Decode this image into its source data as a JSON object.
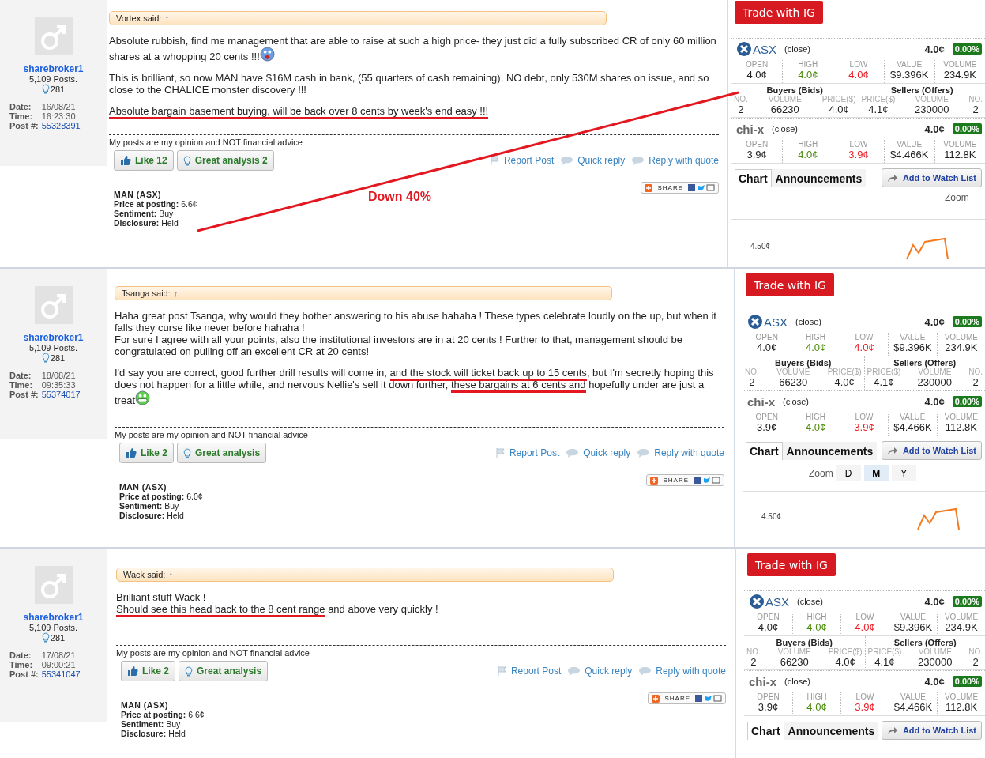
{
  "posts": [
    {
      "user": {
        "name": "sharebroker1",
        "posts": "5,109 Posts.",
        "likes": "281",
        "date_label": "Date:",
        "date": "16/08/21",
        "time_label": "Time:",
        "time": "16:23:30",
        "post_label": "Post #:",
        "post_no": "55328391"
      },
      "quote": {
        "author": "Vortex said:",
        "arrow": "↑"
      },
      "blocks": [
        [
          [
            {
              "kind": "text",
              "text": "Absolute rubbish, find me management that are able to raise at such a high price- they just did a fully subscribed CR of only 60 million shares at a whopping 20 cents !!!",
              "underlined": false
            },
            {
              "kind": "shocked"
            }
          ]
        ],
        [
          [
            {
              "kind": "text",
              "text": "This is brilliant, so now MAN have $16M cash in bank, (55 quarters of cash remaining), NO debt, only 530M shares on issue, and so close to the CHALICE monster discovery !!!",
              "underlined": false
            }
          ]
        ],
        [
          [
            {
              "kind": "text",
              "text": "Absolute bargain basement buying, will be back over 8 cents by week's end easy !!!",
              "underlined": true
            }
          ]
        ]
      ],
      "signature": "My posts are my opinion and NOT financial advice",
      "like": "Like 12",
      "great": "Great analysis 2",
      "actions": [
        "Report Post",
        "Quick reply",
        "Reply with quote"
      ],
      "share": "SHARE",
      "stock": {
        "code": "MAN (ASX)",
        "fields": [
          {
            "label": "Price at posting:",
            "value": "6.6¢"
          },
          {
            "label": "Sentiment:",
            "value": "Buy"
          },
          {
            "label": "Disclosure:",
            "value": "Held"
          }
        ]
      },
      "annotation": {
        "text": "Down 40%"
      },
      "market": {
        "trade": "Trade with IG",
        "exchanges": [
          {
            "kind": "asx",
            "name": "ASX",
            "status": "(close)",
            "price": "4.0¢",
            "change": "0.00%",
            "stats": [
              {
                "label": "OPEN",
                "value": "4.0¢",
                "color": "#222222"
              },
              {
                "label": "HIGH",
                "value": "4.0¢",
                "color": "#4a8a0a"
              },
              {
                "label": "LOW",
                "value": "4.0¢",
                "color": "#ee1c25"
              },
              {
                "label": "VALUE",
                "value": "$9.396K",
                "color": "#222222"
              },
              {
                "label": "VOLUME",
                "value": "234.9K",
                "color": "#222222"
              }
            ],
            "depth": [
              {
                "title": "Buyers (Bids)",
                "columns": [
                  "NO.",
                  "VOLUME",
                  "PRICE($)"
                ],
                "values": [
                  "2",
                  "66230",
                  "4.0¢"
                ]
              },
              {
                "title": "Sellers (Offers)",
                "columns": [
                  "PRICE($)",
                  "VOLUME",
                  "NO."
                ],
                "values": [
                  "4.1¢",
                  "230000",
                  "2"
                ]
              }
            ]
          },
          {
            "kind": "chix",
            "name": "chi-x",
            "status": "(close)",
            "price": "4.0¢",
            "change": "0.00%",
            "stats": [
              {
                "label": "OPEN",
                "value": "3.9¢",
                "color": "#222222"
              },
              {
                "label": "HIGH",
                "value": "4.0¢",
                "color": "#4a8a0a"
              },
              {
                "label": "LOW",
                "value": "3.9¢",
                "color": "#ee1c25"
              },
              {
                "label": "VALUE",
                "value": "$4.466K",
                "color": "#222222"
              },
              {
                "label": "VOLUME",
                "value": "112.8K",
                "color": "#222222"
              }
            ]
          }
        ],
        "tabs": [
          {
            "label": "Chart",
            "selected": true
          },
          {
            "label": "Announcements",
            "selected": false
          }
        ],
        "watch": "Add to Watch List",
        "zoom": {
          "label": "Zoom"
        },
        "chart": {
          "axis_label": "4.50¢"
        }
      }
    },
    {
      "user": {
        "name": "sharebroker1",
        "posts": "5,109 Posts.",
        "likes": "281",
        "date_label": "Date:",
        "date": "18/08/21",
        "time_label": "Time:",
        "time": "09:35:33",
        "post_label": "Post #:",
        "post_no": "55374017"
      },
      "quote": {
        "author": "Tsanga said:",
        "arrow": "↑"
      },
      "blocks": [
        [
          [
            {
              "kind": "text",
              "text": "Haha great post Tsanga, why would they bother answering to his abuse hahaha ! These types celebrate loudly on the up, but when it falls they curse like never before hahaha !",
              "underlined": false
            }
          ],
          [
            {
              "kind": "text",
              "text": "For sure I agree with all your points, also the institutional investors are in at 20 cents ! Further to that, management should be congratulated on pulling off an excellent CR at 20 cents!",
              "underlined": false
            }
          ]
        ],
        [
          [
            {
              "kind": "text",
              "text": "I'd say you are correct, good further drill results will come in, ",
              "underlined": false
            },
            {
              "kind": "text",
              "text": "and the stock will ticket back up to 15 cents",
              "underlined": true
            },
            {
              "kind": "text",
              "text": ", but I'm secretly hoping this does not happen for a little while, and nervous Nellie's sell it down further, ",
              "underlined": false
            },
            {
              "kind": "text",
              "text": "these bargains at 6 cents and",
              "underlined": true
            },
            {
              "kind": "text",
              "text": " hopefully under are just a treat",
              "underlined": false
            },
            {
              "kind": "grinning"
            }
          ]
        ]
      ],
      "signature": "My posts are my opinion and NOT financial advice",
      "like": "Like 2",
      "great": "Great analysis",
      "actions": [
        "Report Post",
        "Quick reply",
        "Reply with quote"
      ],
      "share": "SHARE",
      "stock": {
        "code": "MAN (ASX)",
        "fields": [
          {
            "label": "Price at posting:",
            "value": "6.0¢"
          },
          {
            "label": "Sentiment:",
            "value": "Buy"
          },
          {
            "label": "Disclosure:",
            "value": "Held"
          }
        ]
      },
      "market": {
        "trade": "Trade with IG",
        "exchanges": [
          {
            "kind": "asx",
            "name": "ASX",
            "status": "(close)",
            "price": "4.0¢",
            "change": "0.00%",
            "stats": [
              {
                "label": "OPEN",
                "value": "4.0¢",
                "color": "#222222"
              },
              {
                "label": "HIGH",
                "value": "4.0¢",
                "color": "#4a8a0a"
              },
              {
                "label": "LOW",
                "value": "4.0¢",
                "color": "#ee1c25"
              },
              {
                "label": "VALUE",
                "value": "$9.396K",
                "color": "#222222"
              },
              {
                "label": "VOLUME",
                "value": "234.9K",
                "color": "#222222"
              }
            ],
            "depth": [
              {
                "title": "Buyers (Bids)",
                "columns": [
                  "NO.",
                  "VOLUME",
                  "PRICE($)"
                ],
                "values": [
                  "2",
                  "66230",
                  "4.0¢"
                ]
              },
              {
                "title": "Sellers (Offers)",
                "columns": [
                  "PRICE($)",
                  "VOLUME",
                  "NO."
                ],
                "values": [
                  "4.1¢",
                  "230000",
                  "2"
                ]
              }
            ]
          },
          {
            "kind": "chix",
            "name": "chi-x",
            "status": "(close)",
            "price": "4.0¢",
            "change": "0.00%",
            "stats": [
              {
                "label": "OPEN",
                "value": "3.9¢",
                "color": "#222222"
              },
              {
                "label": "HIGH",
                "value": "4.0¢",
                "color": "#4a8a0a"
              },
              {
                "label": "LOW",
                "value": "3.9¢",
                "color": "#ee1c25"
              },
              {
                "label": "VALUE",
                "value": "$4.466K",
                "color": "#222222"
              },
              {
                "label": "VOLUME",
                "value": "112.8K",
                "color": "#222222"
              }
            ]
          }
        ],
        "tabs": [
          {
            "label": "Chart",
            "selected": true
          },
          {
            "label": "Announcements",
            "selected": false
          }
        ],
        "watch": "Add to Watch List",
        "zoom": {
          "label": "Zoom",
          "options": [
            {
              "label": "D",
              "selected": false
            },
            {
              "label": "M",
              "selected": true
            },
            {
              "label": "Y",
              "selected": false
            }
          ]
        },
        "chart": {
          "axis_label": "4.50¢"
        }
      }
    },
    {
      "user": {
        "name": "sharebroker1",
        "posts": "5,109 Posts.",
        "likes": "281",
        "date_label": "Date:",
        "date": "17/08/21",
        "time_label": "Time:",
        "time": "09:00:21",
        "post_label": "Post #:",
        "post_no": "55341047"
      },
      "quote": {
        "author": "Wack said:",
        "arrow": "↑"
      },
      "blocks": [
        [
          [
            {
              "kind": "text",
              "text": "Brilliant stuff Wack !",
              "underlined": false
            }
          ],
          [
            {
              "kind": "text",
              "text": "Should see this head back to the 8 cent range",
              "underlined": true
            },
            {
              "kind": "text",
              "text": " and above very quickly !",
              "underlined": false
            }
          ]
        ]
      ],
      "signature": "My posts are my opinion and NOT financial advice",
      "like": "Like 2",
      "great": "Great analysis",
      "actions": [
        "Report Post",
        "Quick reply",
        "Reply with quote"
      ],
      "share": "SHARE",
      "stock": {
        "code": "MAN (ASX)",
        "fields": [
          {
            "label": "Price at posting:",
            "value": "6.6¢"
          },
          {
            "label": "Sentiment:",
            "value": "Buy"
          },
          {
            "label": "Disclosure:",
            "value": "Held"
          }
        ]
      },
      "market": {
        "trade": "Trade with IG",
        "exchanges": [
          {
            "kind": "asx",
            "name": "ASX",
            "status": "(close)",
            "price": "4.0¢",
            "change": "0.00%",
            "stats": [
              {
                "label": "OPEN",
                "value": "4.0¢",
                "color": "#222222"
              },
              {
                "label": "HIGH",
                "value": "4.0¢",
                "color": "#4a8a0a"
              },
              {
                "label": "LOW",
                "value": "4.0¢",
                "color": "#ee1c25"
              },
              {
                "label": "VALUE",
                "value": "$9.396K",
                "color": "#222222"
              },
              {
                "label": "VOLUME",
                "value": "234.9K",
                "color": "#222222"
              }
            ],
            "depth": [
              {
                "title": "Buyers (Bids)",
                "columns": [
                  "NO.",
                  "VOLUME",
                  "PRICE($)"
                ],
                "values": [
                  "2",
                  "66230",
                  "4.0¢"
                ]
              },
              {
                "title": "Sellers (Offers)",
                "columns": [
                  "PRICE($)",
                  "VOLUME",
                  "NO."
                ],
                "values": [
                  "4.1¢",
                  "230000",
                  "2"
                ]
              }
            ]
          },
          {
            "kind": "chix",
            "name": "chi-x",
            "status": "(close)",
            "price": "4.0¢",
            "change": "0.00%",
            "stats": [
              {
                "label": "OPEN",
                "value": "3.9¢",
                "color": "#222222"
              },
              {
                "label": "HIGH",
                "value": "4.0¢",
                "color": "#4a8a0a"
              },
              {
                "label": "LOW",
                "value": "3.9¢",
                "color": "#ee1c25"
              },
              {
                "label": "VALUE",
                "value": "$4.466K",
                "color": "#222222"
              },
              {
                "label": "VOLUME",
                "value": "112.8K",
                "color": "#222222"
              }
            ]
          }
        ],
        "tabs": [
          {
            "label": "Chart",
            "selected": true
          },
          {
            "label": "Announcements",
            "selected": false
          }
        ],
        "watch": "Add to Watch List"
      }
    }
  ]
}
